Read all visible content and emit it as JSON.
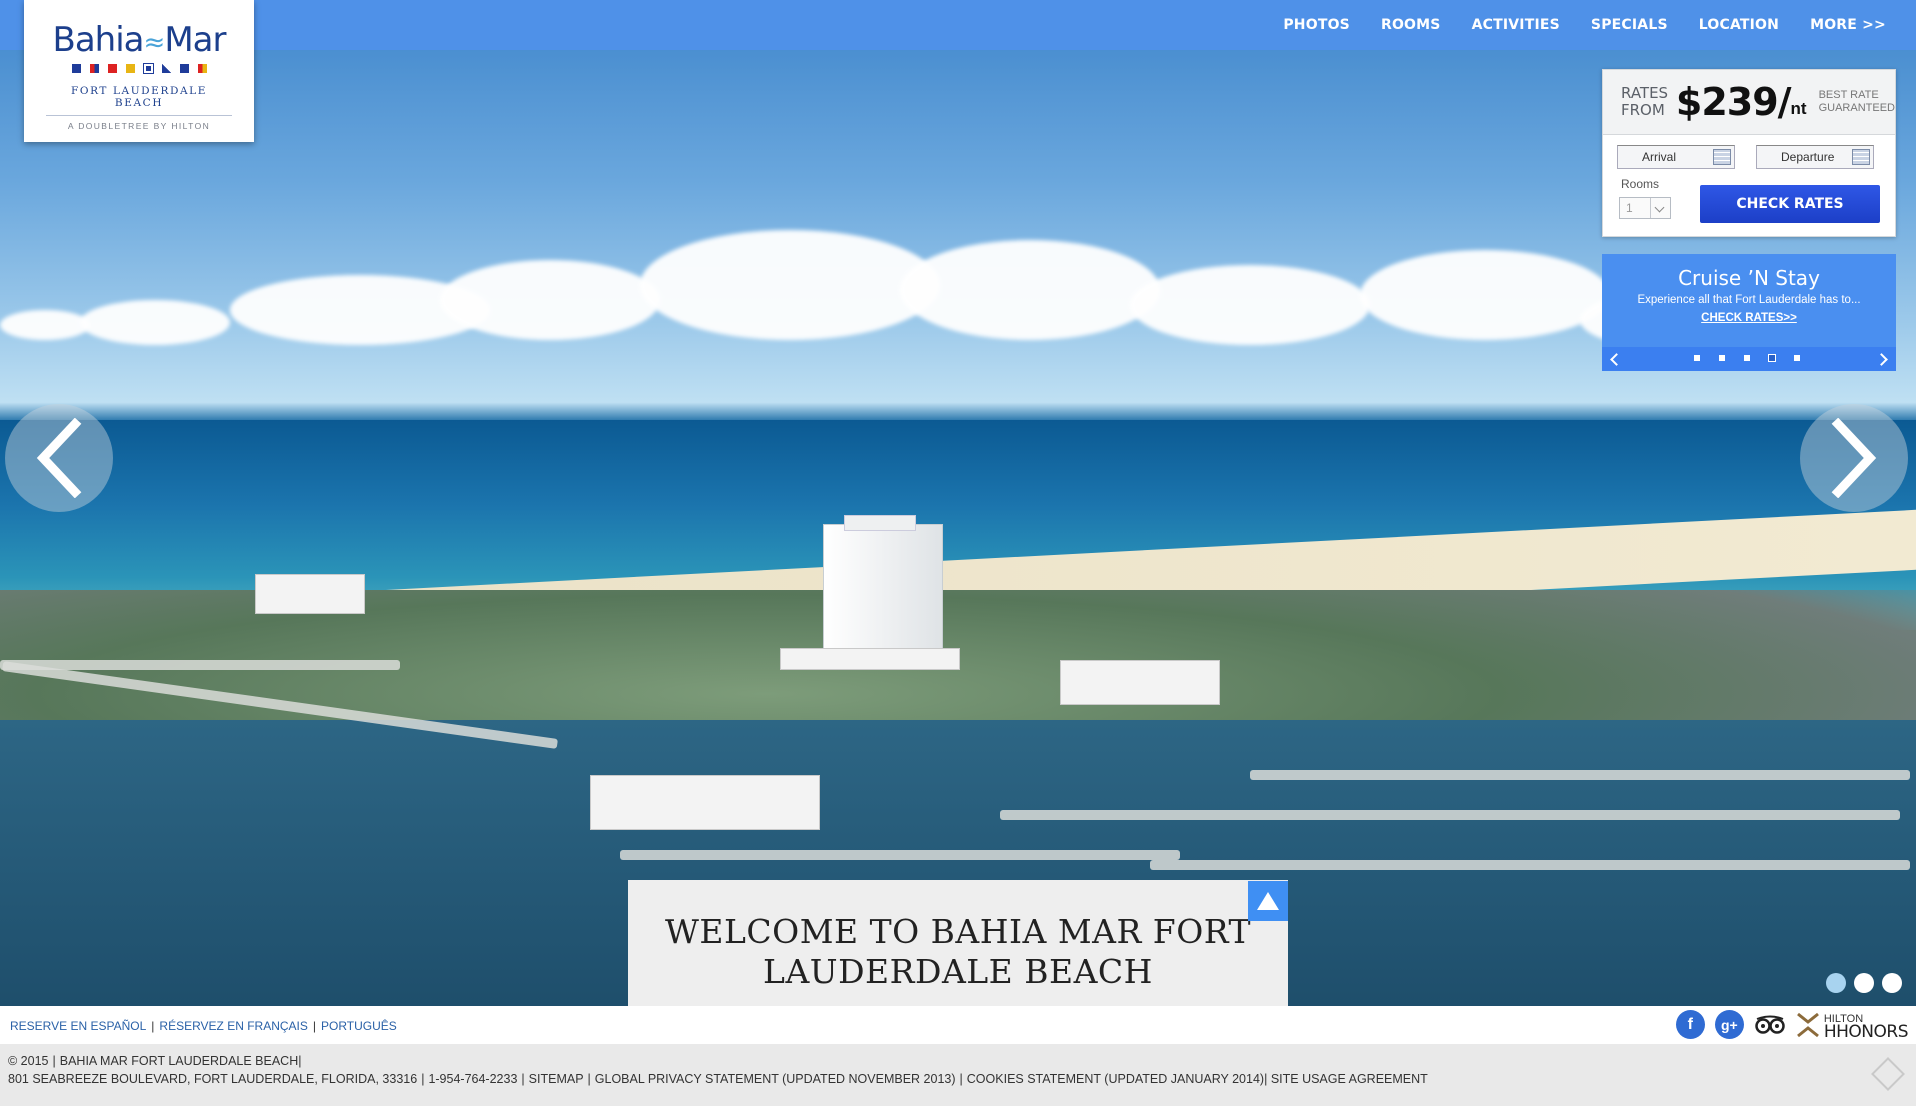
{
  "brand": {
    "logo_name_left": "Bahia",
    "logo_name_right": "Mar",
    "subtitle": "FORT LAUDERDALE BEACH",
    "tagline": "A DOUBLETREE BY HILTON"
  },
  "nav": {
    "items": [
      "PHOTOS",
      "ROOMS",
      "ACTIVITIES",
      "SPECIALS",
      "LOCATION",
      "MORE >>"
    ]
  },
  "booking": {
    "rates_line1": "RATES",
    "rates_line2": "FROM",
    "price": "$239/",
    "per": "nt",
    "best_line1": "BEST RATE",
    "best_line2": "GUARANTEED",
    "arrival": "Arrival",
    "departure": "Departure",
    "rooms_label": "Rooms",
    "rooms_value": "1",
    "check_button": "CHECK RATES"
  },
  "promo": {
    "title": "Cruise ’N Stay",
    "description": "Experience all that Fort Lauderdale has to...",
    "link": "CHECK RATES>>",
    "slide_count": 5,
    "active_slide": 4
  },
  "hero": {
    "welcome_line1": "WELCOME TO BAHIA MAR FORT",
    "welcome_line2": "LAUDERDALE BEACH",
    "slide_count": 3,
    "active_slide": 1
  },
  "languages": {
    "spanish": "RESERVE EN ESPAÑOL",
    "french": "RÉSERVEZ EN FRANÇAIS",
    "portuguese": "PORTUGUÊS",
    "separator": "|"
  },
  "social": {
    "facebook": "f",
    "googleplus": "g+",
    "hhonors_small": "HILTON",
    "hhonors_big": "HHONORS"
  },
  "footer": {
    "line1_copyright": "© 2015",
    "line1_name": "BAHIA MAR FORT LAUDERDALE BEACH",
    "address": "801 SEABREEZE BOULEVARD, FORT LAUDERDALE, FLORIDA, 33316",
    "phone": "1-954-764-2233",
    "sitemap": "SITEMAP",
    "privacy": "GLOBAL PRIVACY STATEMENT (UPDATED NOVEMBER 2013)",
    "cookies": "COOKIES STATEMENT (UPDATED JANUARY 2014)",
    "usage": "SITE USAGE AGREEMENT"
  },
  "colors": {
    "topbar": "#4f91e8",
    "check_button": "#2447d4",
    "promo": "#4a8ff0",
    "logo_blue": "#1c3f8c"
  },
  "icons": [
    "chevron-left-icon",
    "chevron-right-icon",
    "calendar-icon",
    "dropdown-arrow-icon",
    "scroll-up-icon",
    "facebook-icon",
    "googleplus-icon",
    "tripadvisor-icon",
    "hhonors-icon"
  ]
}
